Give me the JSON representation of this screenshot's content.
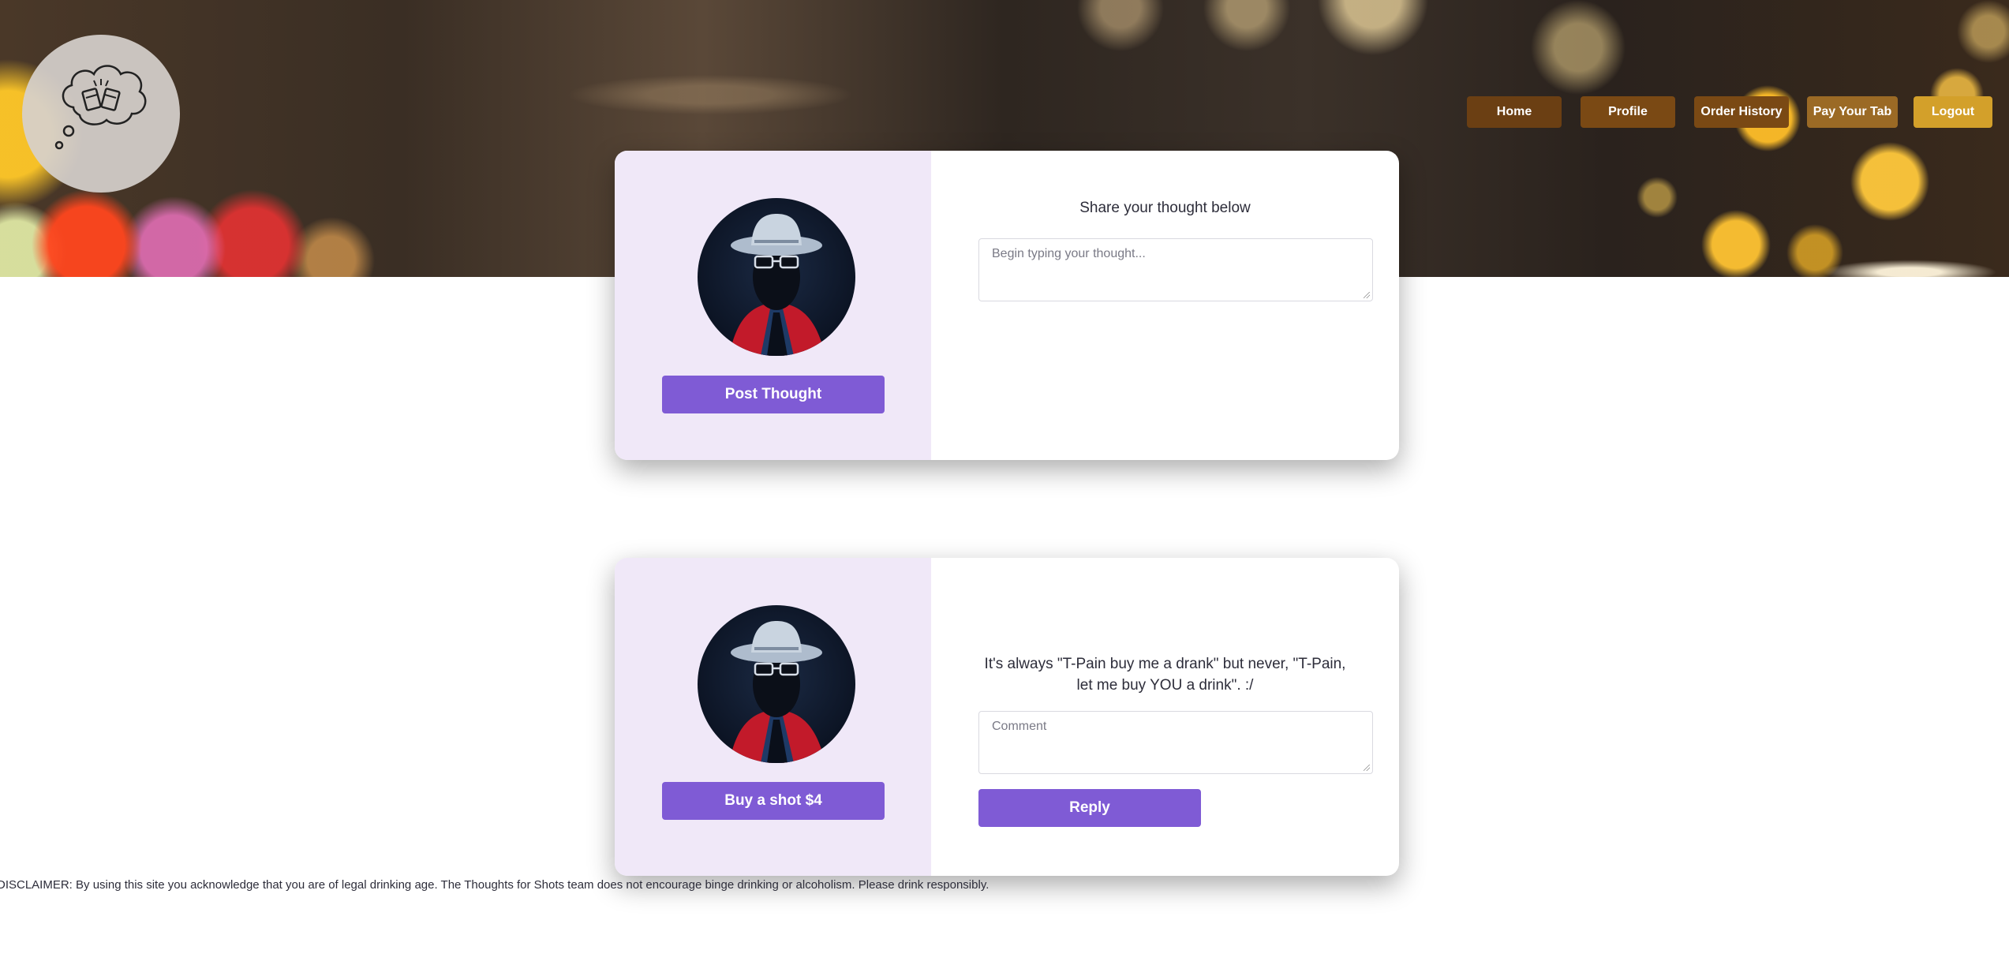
{
  "logo": {
    "icon": "cheers-thought-bubble-icon"
  },
  "nav": {
    "home": "Home",
    "profile": "Profile",
    "order_history": "Order History",
    "pay_tab": "Pay Your Tab",
    "logout": "Logout"
  },
  "post_card": {
    "prompt": "Share your thought below",
    "placeholder": "Begin typing your thought...",
    "button": "Post Thought"
  },
  "thought_card": {
    "text": "It's always \"T-Pain buy me a drank\" but never, \"T-Pain, let me buy YOU a drink\". :/",
    "comment_placeholder": "Comment",
    "buy_button": "Buy a shot $4",
    "reply_button": "Reply"
  },
  "disclaimer": "DISCLAIMER: By using this site you acknowledge that you are of legal drinking age. The Thoughts for Shots team does not encourage binge drinking or alcoholism. Please drink responsibly.",
  "colors": {
    "accent": "#7f5bd5",
    "card_left_bg": "#f0e8f8",
    "nav_home": "#6b3f13",
    "nav_logout": "#d3a02a"
  }
}
